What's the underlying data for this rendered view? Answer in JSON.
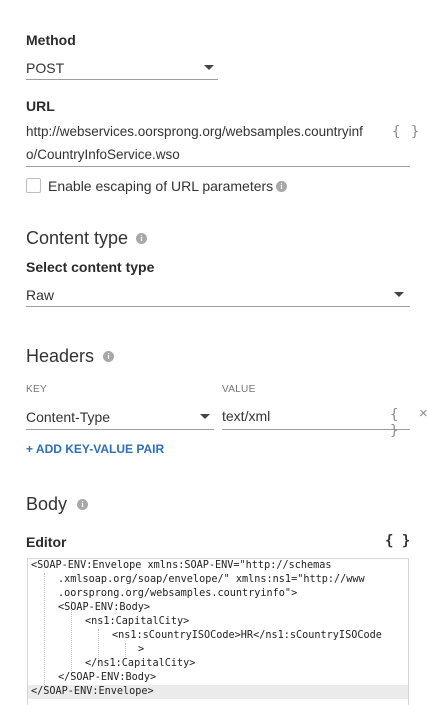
{
  "method": {
    "label": "Method",
    "value": "POST"
  },
  "url": {
    "label": "URL",
    "line1": "http://webservices.oorsprong.org/websamples.countryinf",
    "line2": "o/CountryInfoService.wso",
    "escape_label": "Enable escaping of URL parameters",
    "escape_checked": false
  },
  "content_type": {
    "title": "Content type",
    "select_label": "Select content type",
    "value": "Raw"
  },
  "headers": {
    "title": "Headers",
    "key_col": "KEY",
    "value_col": "VALUE",
    "rows": [
      {
        "key": "Content-Type",
        "value": "text/xml"
      }
    ],
    "add_label": "+ ADD KEY-VALUE PAIR"
  },
  "body": {
    "title": "Body",
    "editor_label": "Editor",
    "format_icon": "{ }",
    "lines": [
      "<SOAP-ENV:Envelope xmlns:SOAP-ENV=\"http://schemas",
      ".xmlsoap.org/soap/envelope/\" xmlns:ns1=\"http://www",
      ".oorsprong.org/websamples.countryinfo\">",
      "<SOAP-ENV:Body>",
      "<ns1:CapitalCity>",
      "<ns1:sCountryISOCode>HR</ns1:sCountryISOCode",
      ">",
      "</ns1:CapitalCity>",
      "</SOAP-ENV:Body>",
      "</SOAP-ENV:Envelope>"
    ]
  },
  "icons": {
    "info": "info-icon",
    "variable": "curly-braces-icon",
    "dropdown": "chevron-down-icon",
    "remove": "close-icon"
  }
}
